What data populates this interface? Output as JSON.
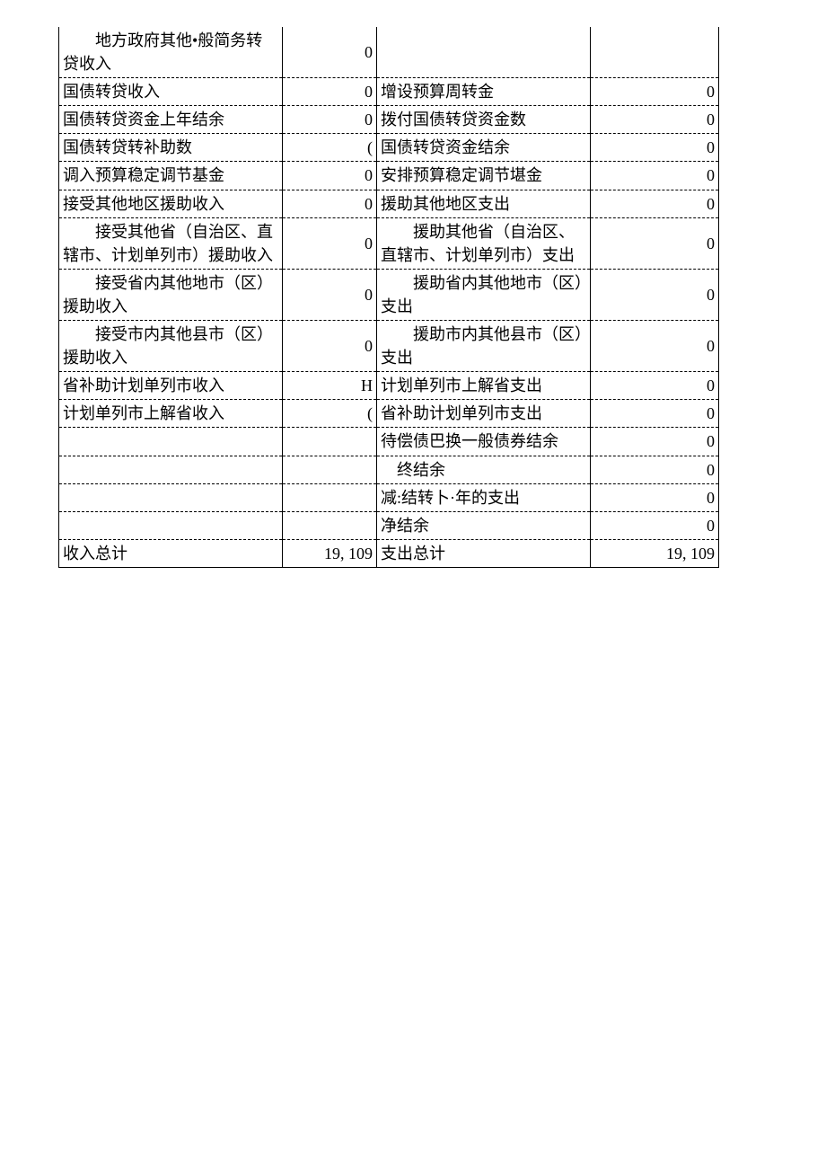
{
  "rows": [
    {
      "l": "　　地方政府其他•般简务转贷收入",
      "lv": "0",
      "r": "",
      "rv": ""
    },
    {
      "l": "国债转贷收入",
      "lv": "0",
      "r": "增设预算周转金",
      "rv": "0"
    },
    {
      "l": "国债转贷资金上年结余",
      "lv": "0",
      "r": "拨付国债转贷资金数",
      "rv": "0"
    },
    {
      "l": "国债转贷转补助数",
      "lv": "(",
      "r": "国债转贷资金结余",
      "rv": "0"
    },
    {
      "l": "调入预算稳定调节基金",
      "lv": "0",
      "r": "安排预算稳定调节堪金",
      "rv": "0"
    },
    {
      "l": "接受其他地区援助收入",
      "lv": "0",
      "r": "援助其他地区支出",
      "rv": "0"
    },
    {
      "l": "　　接受其他省（自治区、直辖市、计划单列市）援助收入",
      "lv": "0",
      "r": "　　援助其他省（自治区、直辖市、计划单列市）支出",
      "rv": "0"
    },
    {
      "l": "　　接受省内其他地市（区）援助收入",
      "lv": "0",
      "r": "　　援助省内其他地市（区）支出",
      "rv": "0"
    },
    {
      "l": "　　接受市内其他县市（区）援助收入",
      "lv": "0",
      "r": "　　援助市内其他县市（区）支出",
      "rv": "0"
    },
    {
      "l": "省补助计划单列市收入",
      "lv": "H",
      "r": "计划单列市上解省支出",
      "rv": "0"
    },
    {
      "l": "计划单列市上解省收入",
      "lv": "(",
      "r": "省补助计划单列市支出",
      "rv": "0"
    },
    {
      "l": "",
      "lv": "",
      "r": "待偿债巴换一般债券结余",
      "rv": "0"
    },
    {
      "l": "",
      "lv": "",
      "r": "　终结余",
      "rv": "0"
    },
    {
      "l": "",
      "lv": "",
      "r": "减:结转卜·年的支出",
      "rv": "0"
    },
    {
      "l": "",
      "lv": "",
      "r": "净结余",
      "rv": "0"
    }
  ],
  "total": {
    "l": "收入总计",
    "lv": "19, 109",
    "r": "支出总计",
    "rv": "19, 109"
  }
}
